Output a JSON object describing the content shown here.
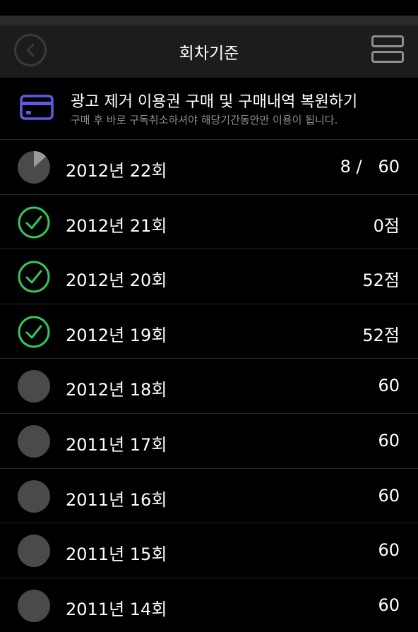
{
  "header": {
    "title": "회차기준"
  },
  "promo": {
    "title": "광고 제거 이용권 구매 및 구매내역 복원하기",
    "subtitle": "구매 후 바로 구독취소하셔야 해당기간동안만 이용이 됩니다."
  },
  "colors": {
    "accent_purple": "#5e5ce6",
    "check_green": "#34c759",
    "circle_gray": "#4a4a4c"
  },
  "rounds": [
    {
      "label": "2012년 22회",
      "score": "8 /   60",
      "status": "in-progress",
      "progress": 0.133
    },
    {
      "label": "2012년 21회",
      "score": "0점",
      "status": "completed"
    },
    {
      "label": "2012년 20회",
      "score": "52점",
      "status": "completed"
    },
    {
      "label": "2012년 19회",
      "score": "52점",
      "status": "completed"
    },
    {
      "label": "2012년 18회",
      "score": "60",
      "status": "not-started"
    },
    {
      "label": "2011년 17회",
      "score": "60",
      "status": "not-started"
    },
    {
      "label": "2011년 16회",
      "score": "60",
      "status": "not-started"
    },
    {
      "label": "2011년 15회",
      "score": "60",
      "status": "not-started"
    },
    {
      "label": "2011년 14회",
      "score": "60",
      "status": "not-started"
    }
  ]
}
